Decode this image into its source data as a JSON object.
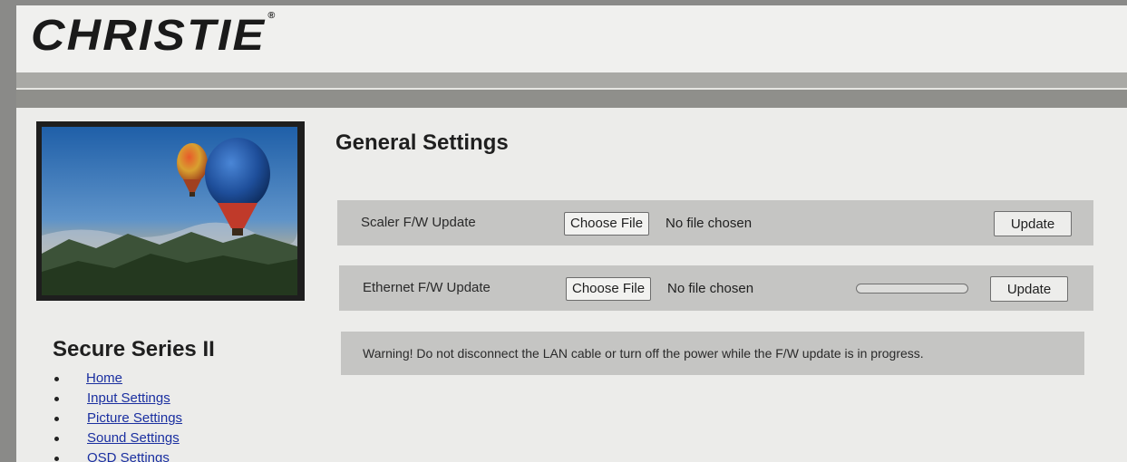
{
  "header": {
    "logo_text": "CHRISTIE",
    "logo_mark": "®"
  },
  "sidebar": {
    "hero_image": "hot-air-balloons-over-mountains",
    "product_title": "Secure Series II",
    "nav": [
      {
        "label": "Home"
      },
      {
        "label": "Input Settings"
      },
      {
        "label": "Picture Settings"
      },
      {
        "label": "Sound Settings"
      },
      {
        "label": "OSD Settings"
      }
    ]
  },
  "main": {
    "title": "General Settings",
    "scaler": {
      "label": "Scaler F/W Update",
      "choose_label": "Choose File",
      "file_status": "No file chosen",
      "update_label": "Update"
    },
    "ethernet": {
      "label": "Ethernet F/W Update",
      "choose_label": "Choose File",
      "file_status": "No file chosen",
      "progress": 0,
      "update_label": "Update"
    },
    "warning": "Warning! Do not disconnect the LAN cable or turn off the power while the F/W update is in progress."
  },
  "colors": {
    "link": "#1a2fa0",
    "row_background": "#c5c5c3",
    "band_dark": "#8f8f8b"
  }
}
